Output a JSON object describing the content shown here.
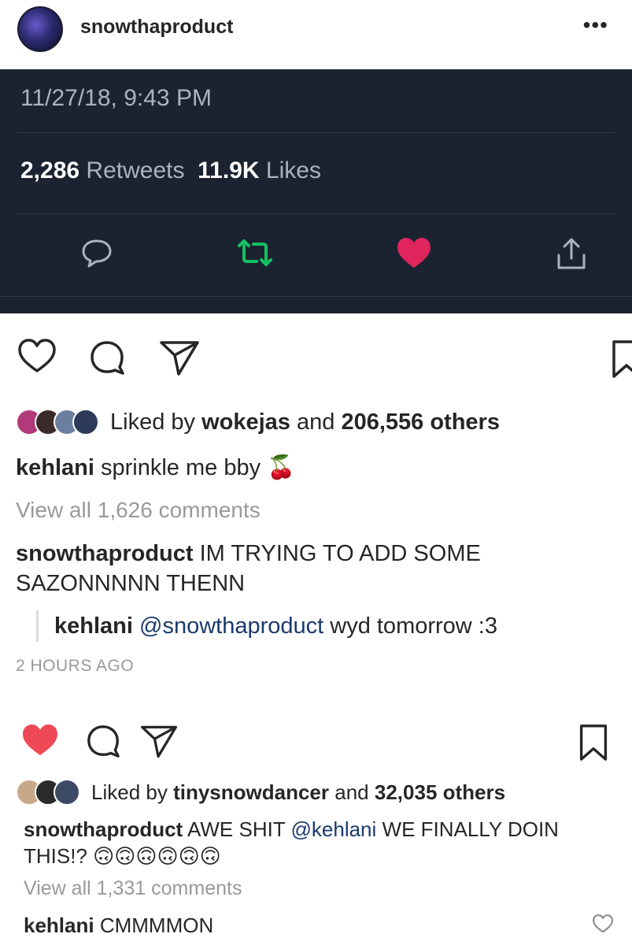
{
  "header": {
    "username": "snowthaproduct",
    "more_label": "•••"
  },
  "tweet": {
    "datetime": "11/27/18, 9:43 PM",
    "retweets_count": "2,286",
    "retweets_label": "Retweets",
    "likes_count": "11.9K",
    "likes_label": "Likes",
    "colors": {
      "retweet": "#17bf63",
      "like": "#e0245e",
      "muted": "#a9b4bf"
    }
  },
  "post1": {
    "liked_prefix": "Liked by",
    "liked_user": "wokejas",
    "liked_and": "and",
    "liked_count": "206,556 others",
    "caption_user": "kehlani",
    "caption_text": "sprinkle me bby",
    "caption_emoji": "🍒",
    "view_all": "View all 1,626 comments",
    "comment_user": "snowthaproduct",
    "comment_text_line1": "IM TRYING TO ADD SOME",
    "comment_text_line2": "SAZONNNNN THENN",
    "reply_user": "kehlani",
    "reply_mention": "@snowthaproduct",
    "reply_text": "wyd tomorrow :3",
    "time_ago": "2 HOURS AGO"
  },
  "post2": {
    "liked_prefix": "Liked by",
    "liked_user": "tinysnowdancer",
    "liked_and": "and",
    "liked_count": "32,035 others",
    "caption_user": "snowthaproduct",
    "caption_text_a": "AWE SHIT",
    "caption_mention": "@kehlani",
    "caption_text_b": "WE FINALLY DOIN",
    "caption_text_line2": "THIS!?",
    "caption_emojis": "🙃🙃🙃🙃🙃🙃",
    "view_all": "View all 1,331 comments",
    "comment_user": "kehlani",
    "comment_text": "CMMMMON",
    "heart_color": "#ed4956"
  }
}
